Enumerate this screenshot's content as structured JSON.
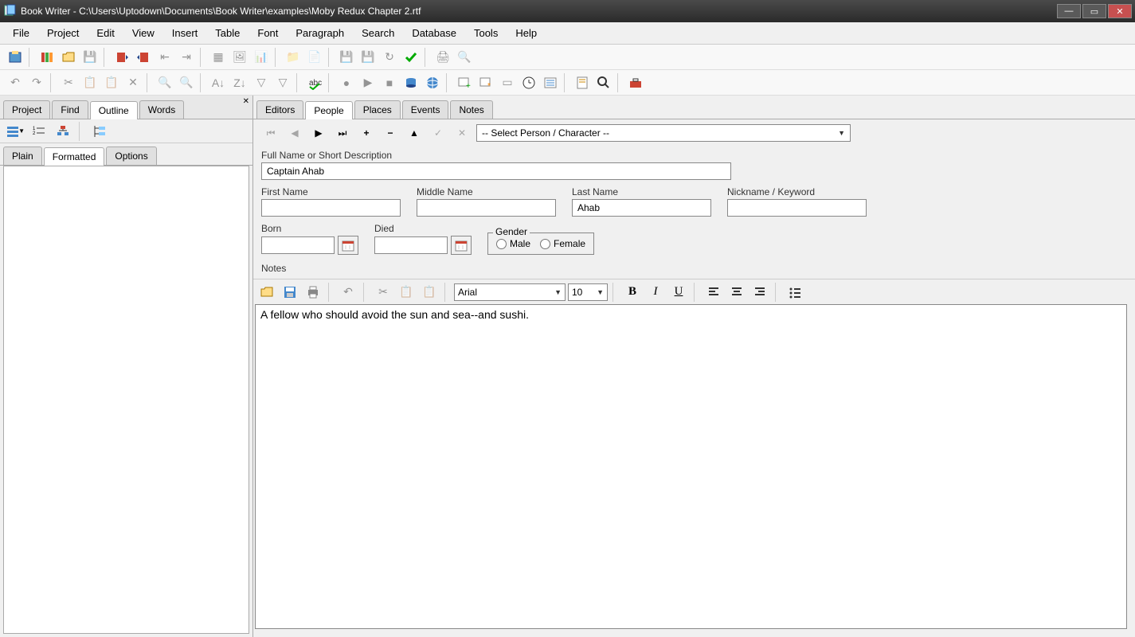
{
  "window": {
    "title": "Book Writer - C:\\Users\\Uptodown\\Documents\\Book Writer\\examples\\Moby Redux Chapter 2.rtf"
  },
  "menu": [
    "File",
    "Project",
    "Edit",
    "View",
    "Insert",
    "Table",
    "Font",
    "Paragraph",
    "Search",
    "Database",
    "Tools",
    "Help"
  ],
  "left_panel": {
    "tabs": [
      "Project",
      "Find",
      "Outline",
      "Words"
    ],
    "active_tab": "Outline",
    "subtabs": [
      "Plain",
      "Formatted",
      "Options"
    ],
    "active_subtab": "Formatted"
  },
  "right_panel": {
    "tabs": [
      "Editors",
      "People",
      "Places",
      "Events",
      "Notes"
    ],
    "active_tab": "People",
    "select_placeholder": "-- Select Person / Character --",
    "labels": {
      "full_name": "Full Name or Short Description",
      "first_name": "First Name",
      "middle_name": "Middle Name",
      "last_name": "Last Name",
      "nickname": "Nickname / Keyword",
      "born": "Born",
      "died": "Died",
      "gender": "Gender",
      "male": "Male",
      "female": "Female",
      "notes": "Notes"
    },
    "values": {
      "full_name": "Captain Ahab",
      "first_name": "",
      "middle_name": "",
      "last_name": "Ahab",
      "nickname": "",
      "born": "",
      "died": ""
    },
    "notes_toolbar": {
      "font": "Arial",
      "size": "10"
    },
    "notes_text": "A fellow who should avoid the sun and sea--and sushi."
  }
}
